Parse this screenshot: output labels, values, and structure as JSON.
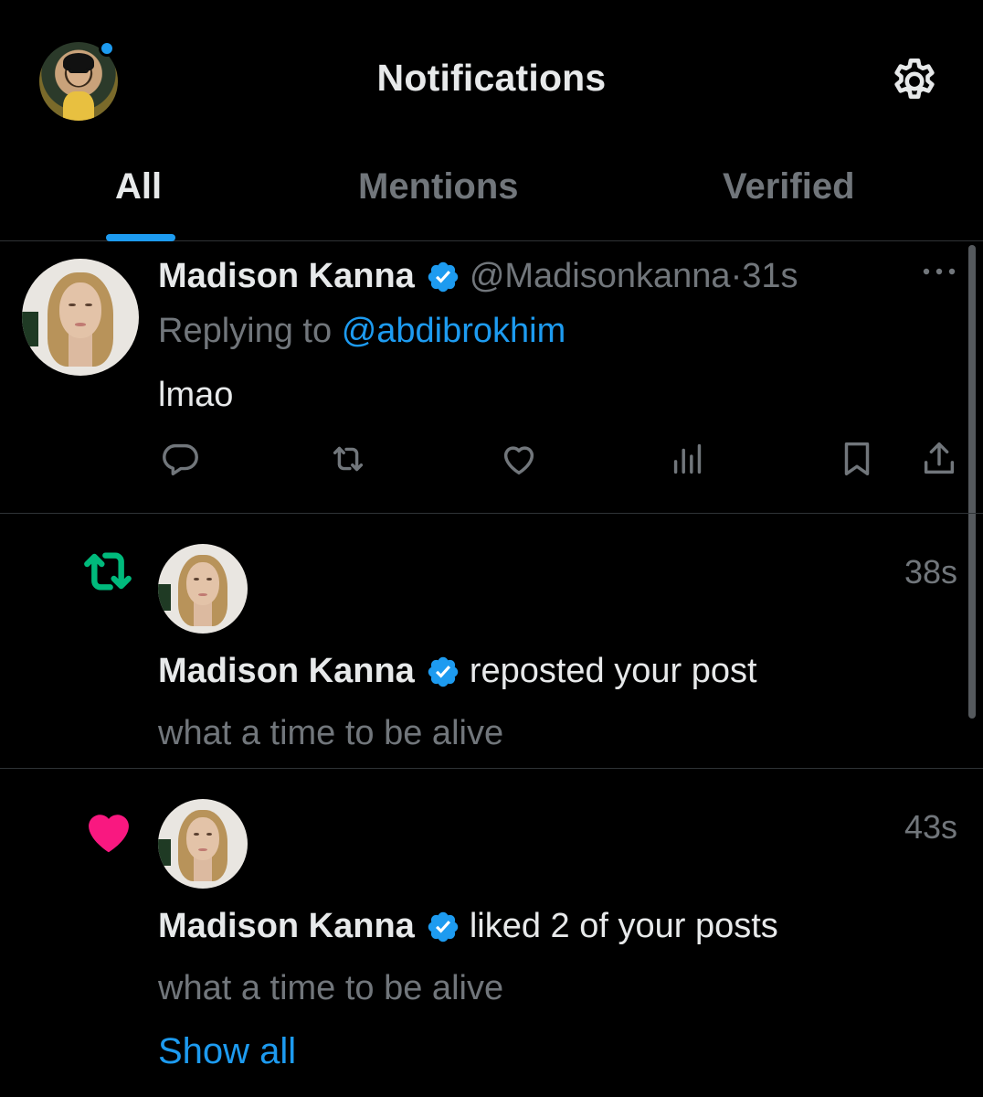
{
  "header": {
    "title": "Notifications"
  },
  "tabs": [
    {
      "label": "All",
      "active": true
    },
    {
      "label": "Mentions",
      "active": false
    },
    {
      "label": "Verified",
      "active": false
    }
  ],
  "notifications": [
    {
      "type": "reply",
      "name": "Madison Kanna",
      "handle": "@Madisonkanna",
      "time": "31s",
      "replying_prefix": "Replying to",
      "replying_to": "@abdibrokhim",
      "text": "lmao",
      "actions": [
        "reply-icon",
        "repost-icon",
        "like-icon",
        "views-icon",
        "bookmark-icon",
        "share-icon"
      ]
    },
    {
      "type": "repost",
      "icon": "repost-icon",
      "icon_color": "#00ba7c",
      "name": "Madison Kanna",
      "action": "reposted your post",
      "time": "38s",
      "snippet": "what a time to be alive"
    },
    {
      "type": "like",
      "icon": "heart-icon",
      "icon_color": "#f91880",
      "name": "Madison Kanna",
      "action": "liked 2 of your posts",
      "time": "43s",
      "snippet": "what a time to be alive",
      "show_all": "Show all"
    }
  ],
  "colors": {
    "accent": "#1d9bf0",
    "background": "#000000",
    "muted": "#71767b",
    "text": "#e7e9ea"
  }
}
